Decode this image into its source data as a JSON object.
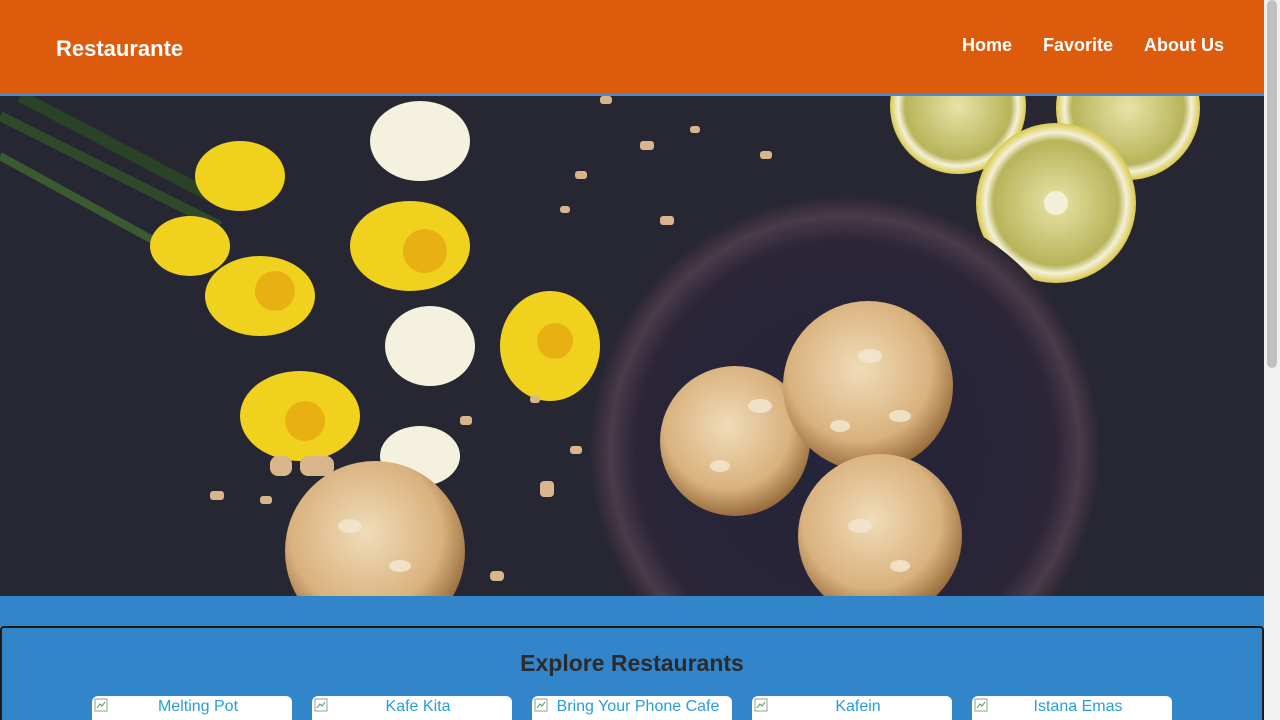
{
  "header": {
    "brand": "Restaurante",
    "nav": [
      {
        "label": "Home"
      },
      {
        "label": "Favorite"
      },
      {
        "label": "About Us"
      }
    ]
  },
  "hero": {
    "image": "cookies-flowers-lemon-hero"
  },
  "explore": {
    "title": "Explore Restaurants",
    "restaurants": [
      {
        "name": "Melting Pot"
      },
      {
        "name": "Kafe Kita"
      },
      {
        "name": "Bring Your Phone Cafe"
      },
      {
        "name": "Kafein"
      },
      {
        "name": "Istana Emas"
      }
    ]
  },
  "colors": {
    "header": "#dc5b0c",
    "background": "#3385c9",
    "link": "#2a9dd9"
  }
}
